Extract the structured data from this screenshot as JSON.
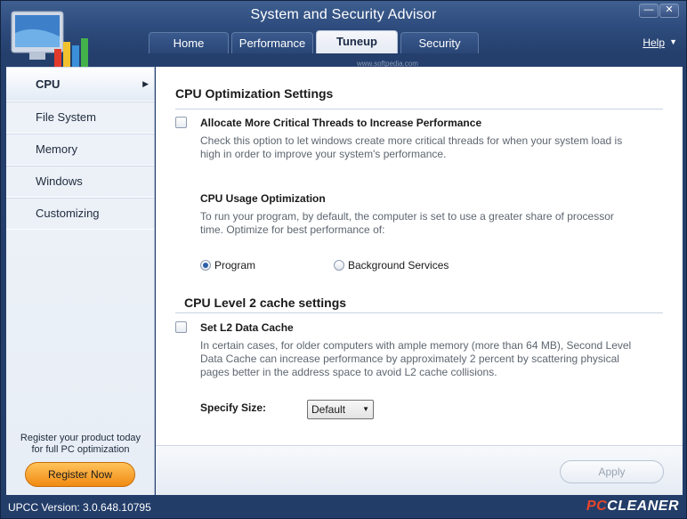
{
  "window": {
    "title": "System and Security Advisor",
    "minimize_icon": "minimize-icon",
    "close_icon": "close-icon"
  },
  "tabs": [
    {
      "label": "Home",
      "active": false
    },
    {
      "label": "Performance",
      "active": false
    },
    {
      "label": "Tuneup",
      "active": true
    },
    {
      "label": "Security",
      "active": false
    }
  ],
  "help_label": "Help",
  "watermark": "www.softpedia.com",
  "sidebar": {
    "items": [
      {
        "label": "CPU",
        "active": true
      },
      {
        "label": "File System",
        "active": false
      },
      {
        "label": "Memory",
        "active": false
      },
      {
        "label": "Windows",
        "active": false
      },
      {
        "label": "Customizing",
        "active": false
      }
    ],
    "register_text_1": "Register your product today",
    "register_text_2": "for full PC optimization",
    "register_button": "Register Now"
  },
  "main": {
    "section1_title": "CPU Optimization Settings",
    "critical_threads": {
      "label": "Allocate More Critical Threads to Increase Performance",
      "checked": false,
      "desc_1": "Check this option to let windows create more critical threads for when your system load is",
      "desc_2": "high in order to improve your system's performance."
    },
    "usage": {
      "title": "CPU Usage Optimization",
      "desc_1": "To run your program, by default, the computer is set to use a greater share of processor",
      "desc_2": "time. Optimize for best performance of:",
      "option_program": "Program",
      "option_background": "Background Services",
      "selected": "Program"
    },
    "section2_title": "CPU Level 2 cache settings",
    "l2_cache": {
      "label": "Set L2 Data Cache",
      "checked": false,
      "desc_1": "In certain cases, for older computers with ample memory (more than 64 MB), Second Level",
      "desc_2": "Data Cache can increase performance by approximately 2 percent by scattering physical",
      "desc_3": "pages better in the address space to avoid L2 cache collisions."
    },
    "size_label": "Specify Size:",
    "size_value": "Default",
    "apply_label": "Apply"
  },
  "status": {
    "version": "UPCC Version: 3.0.648.10795",
    "brand_pc": "PC",
    "brand_cleaner": "CLEANER"
  }
}
